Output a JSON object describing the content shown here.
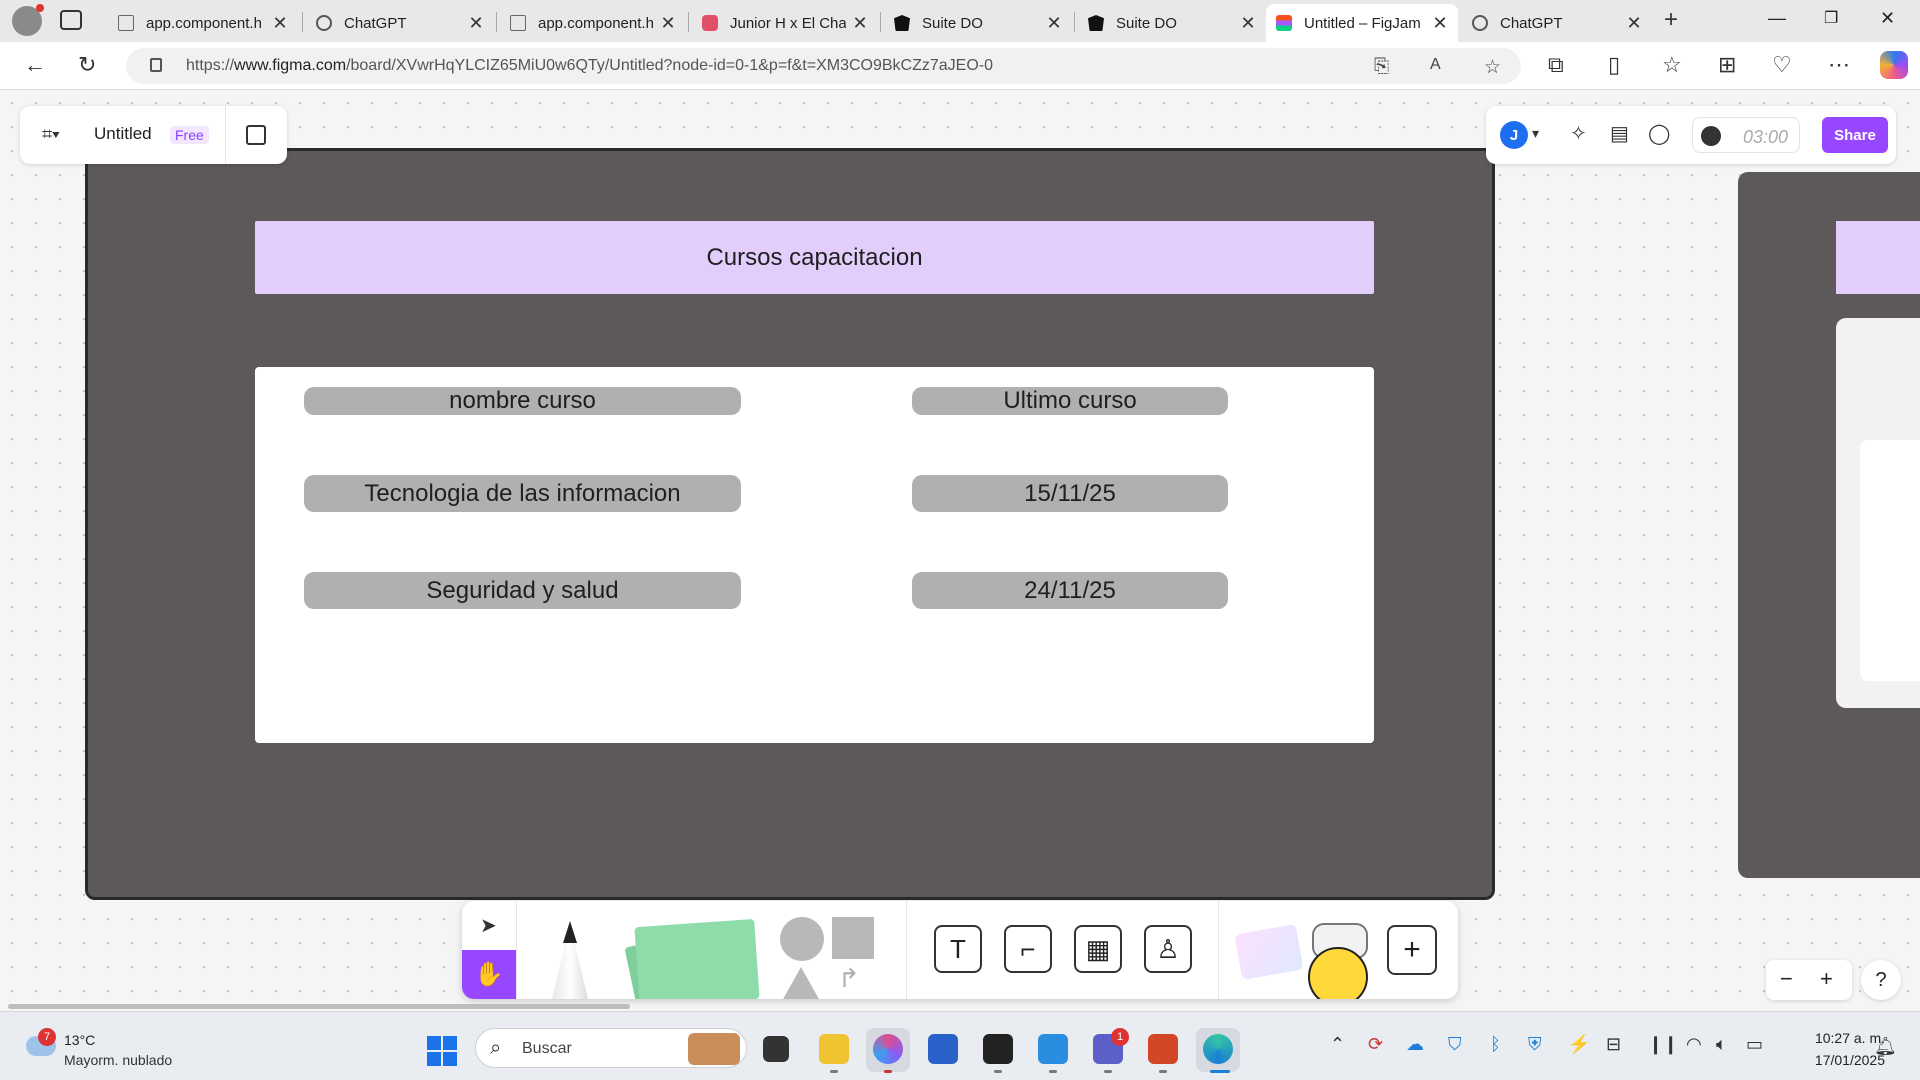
{
  "browser": {
    "tabs": [
      {
        "title": "app.component.h",
        "icon": "doc-icon",
        "active": false
      },
      {
        "title": "ChatGPT",
        "icon": "chatgpt-icon",
        "active": false
      },
      {
        "title": "app.component.h",
        "icon": "doc-icon",
        "active": false
      },
      {
        "title": "Junior H x El Cha",
        "icon": "youtube-icon",
        "active": false
      },
      {
        "title": "Suite DO",
        "icon": "angular-icon",
        "active": false
      },
      {
        "title": "Suite DO",
        "icon": "angular-icon",
        "active": false
      },
      {
        "title": "Untitled – FigJam",
        "icon": "figma-icon",
        "active": true
      },
      {
        "title": "ChatGPT",
        "icon": "chatgpt-icon",
        "active": false
      }
    ],
    "url_prefix": "https://",
    "url_domain": "www.figma.com",
    "url_path": "/board/XVwrHqYLCIZ65MiU0w6QTy/Untitled?node-id=0-1&p=f&t=XM3CO9BkCZz7aJEO-0"
  },
  "figjam": {
    "file_name": "Untitled",
    "plan_badge": "Free",
    "avatar_initial": "J",
    "timer": "03:00",
    "share_label": "Share",
    "accent_color": "#9747ff"
  },
  "board": {
    "title": "Cursos capacitacion",
    "headers": [
      "nombre curso",
      "Ultimo curso"
    ],
    "rows": [
      [
        "Tecnologia de las informacion",
        "15/11/25"
      ],
      [
        "Seguridad y salud",
        "24/11/25"
      ]
    ],
    "section_color": "#5d5859",
    "title_color": "#e2cdfb",
    "pill_color": "#b0b0b0"
  },
  "taskbar": {
    "weather_temp": "13°C",
    "weather_desc": "Mayorm. nublado",
    "weather_badge": "7",
    "search_placeholder": "Buscar",
    "teams_badge": "1",
    "time": "10:27 a. m.",
    "date": "17/01/2025"
  }
}
